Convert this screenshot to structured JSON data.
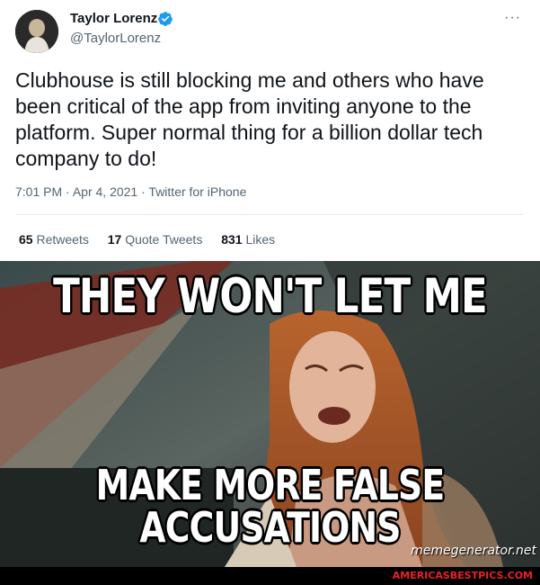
{
  "tweet": {
    "display_name": "Taylor Lorenz",
    "handle": "@TaylorLorenz",
    "more_label": "···",
    "verified_icon": "verified-badge-icon",
    "text": "Clubhouse is still blocking me and others who have been critical of the app from inviting anyone to the platform. Super normal thing for a billion dollar tech company to do!",
    "time": "7:01 PM",
    "date": "Apr 4, 2021",
    "source": "Twitter for iPhone",
    "separator": "·",
    "stats": {
      "retweets_count": "65",
      "retweets_label": "Retweets",
      "quotes_count": "17",
      "quotes_label": "Quote Tweets",
      "likes_count": "831",
      "likes_label": "Likes"
    },
    "colors": {
      "verified": "#1d9bf0",
      "text": "#0f1419",
      "muted": "#536471"
    }
  },
  "meme": {
    "top_text": "THEY WON'T LET ME",
    "bottom_line1": "MAKE MORE FALSE",
    "bottom_line2": "ACCUSATIONS",
    "watermark": "memegenerator.net"
  },
  "footer": {
    "site": "AMERICASBESTPICS.COM",
    "color": "#e8202a"
  }
}
